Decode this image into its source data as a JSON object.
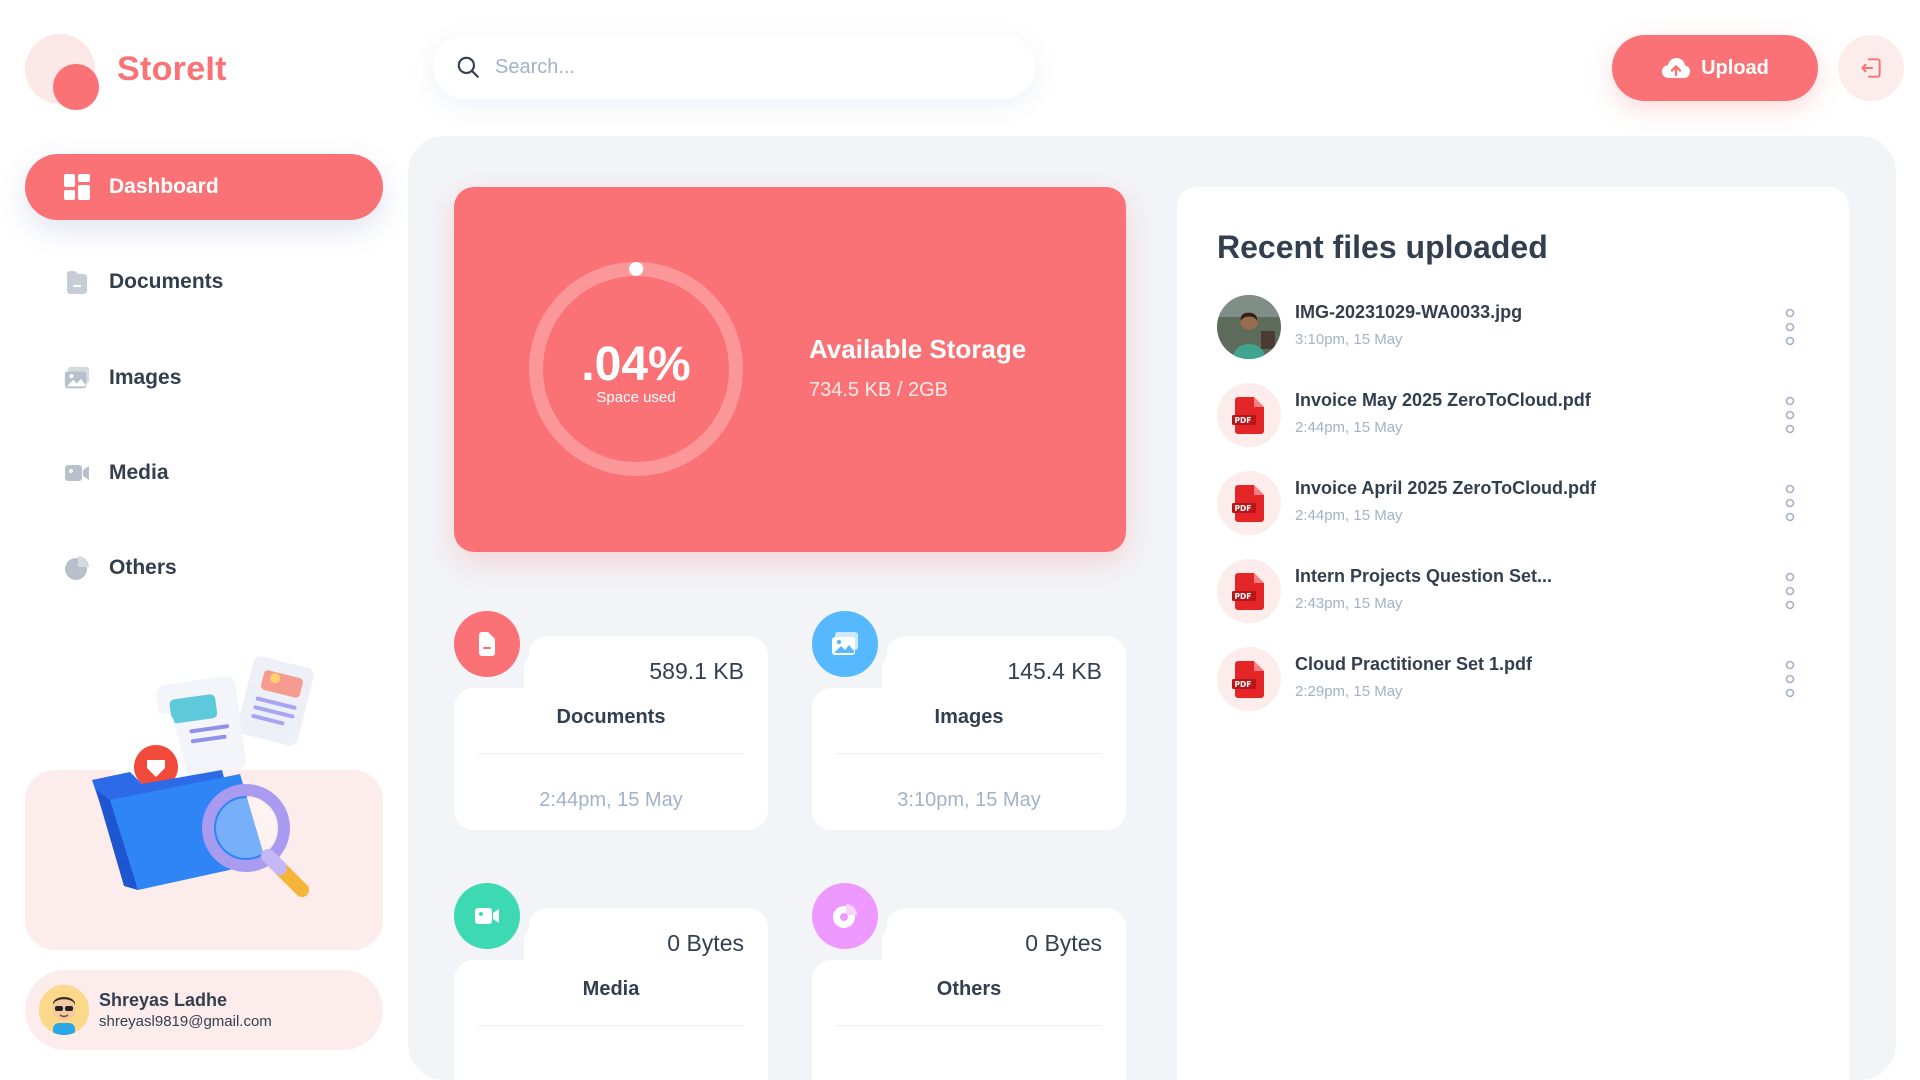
{
  "app": {
    "name": "StoreIt"
  },
  "search": {
    "placeholder": "Search..."
  },
  "header": {
    "upload_label": "Upload"
  },
  "sidebar": {
    "items": [
      {
        "label": "Dashboard",
        "icon": "dashboard-icon",
        "active": true
      },
      {
        "label": "Documents",
        "icon": "documents-icon",
        "active": false
      },
      {
        "label": "Images",
        "icon": "images-icon",
        "active": false
      },
      {
        "label": "Media",
        "icon": "media-icon",
        "active": false
      },
      {
        "label": "Others",
        "icon": "others-icon",
        "active": false
      }
    ]
  },
  "user": {
    "name": "Shreyas Ladhe",
    "email": "shreyasl9819@gmail.com"
  },
  "storage": {
    "percent_label": ".04%",
    "percent_caption": "Space used",
    "used_fraction": 0.0004,
    "title": "Available Storage",
    "value": "734.5 KB / 2GB"
  },
  "categories": [
    {
      "name": "Documents",
      "size": "589.1 KB",
      "time": "2:44pm, 15 May",
      "color": "#fa7275"
    },
    {
      "name": "Images",
      "size": "145.4 KB",
      "time": "3:10pm, 15 May",
      "color": "#56b8ff"
    },
    {
      "name": "Media",
      "size": "0 Bytes",
      "time": "",
      "color": "#3dd9b3"
    },
    {
      "name": "Others",
      "size": "0 Bytes",
      "time": "",
      "color": "#ee99ff"
    }
  ],
  "recent": {
    "title": "Recent files uploaded",
    "files": [
      {
        "name": "IMG-20231029-WA0033.jpg",
        "time": "3:10pm, 15 May",
        "type": "image"
      },
      {
        "name": "Invoice May 2025 ZeroToCloud.pdf",
        "time": "2:44pm, 15 May",
        "type": "pdf"
      },
      {
        "name": "Invoice April 2025 ZeroToCloud.pdf",
        "time": "2:44pm, 15 May",
        "type": "pdf"
      },
      {
        "name": "Intern Projects Question Set...",
        "time": "2:43pm, 15 May",
        "type": "pdf"
      },
      {
        "name": "Cloud Practitioner Set 1.pdf",
        "time": "2:29pm, 15 May",
        "type": "pdf"
      }
    ]
  },
  "colors": {
    "brand": "#fa7275",
    "brand_light": "#fdecec",
    "text": "#333f4e",
    "muted": "#a3b2c7",
    "panel": "#f2f4f8"
  }
}
